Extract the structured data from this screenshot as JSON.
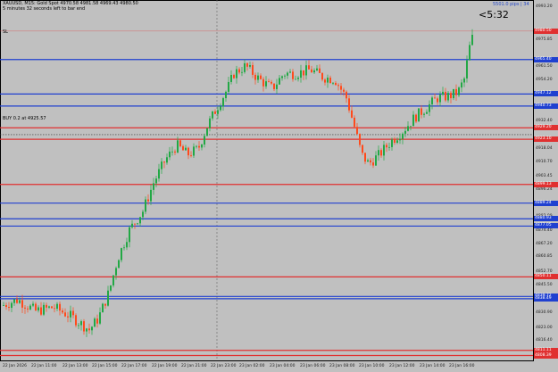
{
  "header": {
    "symbol_line": "XAUUSD, M15: Gold Spot  4970.58 4981.58 4969.43 4980.50",
    "timer_line": "5 minutes 32 seconds left to bar end"
  },
  "labels": {
    "sl": "SL",
    "buy": "BUY 0.2 at 4925.57"
  },
  "countdown": "<5:32",
  "pips_text": "5501.0 pips | 34",
  "y_axis_ticks": [
    "4993.20",
    "4975.85",
    "4961.50",
    "4954.20",
    "4940.20",
    "4932.40",
    "4918.04",
    "4910.70",
    "4903.45",
    "4896.24",
    "4882.09",
    "4874.40",
    "4867.20",
    "4860.85",
    "4852.70",
    "4845.50",
    "4838.30",
    "4830.90",
    "4823.00",
    "4816.40",
    "4809.10"
  ],
  "x_axis_ticks": [
    "22 Jan 2026",
    "22 Jan 11:00",
    "22 Jan 13:00",
    "22 Jan 15:00",
    "22 Jan 17:00",
    "22 Jan 19:00",
    "22 Jan 21:00",
    "22 Jan 23:00",
    "23 Jan 02:00",
    "23 Jan 04:00",
    "23 Jan 06:00",
    "23 Jan 08:00",
    "23 Jan 10:00",
    "23 Jan 12:00",
    "23 Jan 14:00",
    "23 Jan 16:00"
  ],
  "price_tags": [
    {
      "price": 4980.5,
      "text": "4980.50",
      "color": "#e03030"
    },
    {
      "price": 4965.4,
      "text": "4965.40",
      "color": "#2040d0"
    },
    {
      "price": 4947.12,
      "text": "4947.12",
      "color": "#2040d0"
    },
    {
      "price": 4940.73,
      "text": "4940.73",
      "color": "#2040d0"
    },
    {
      "price": 4929.2,
      "text": "4929.20",
      "color": "#e03030"
    },
    {
      "price": 4923.1,
      "text": "4923.10",
      "color": "#e03030"
    },
    {
      "price": 4899.13,
      "text": "4899.13",
      "color": "#e03030"
    },
    {
      "price": 4889.24,
      "text": "4889.24",
      "color": "#2040d0"
    },
    {
      "price": 4880.93,
      "text": "4880.93",
      "color": "#2040d0"
    },
    {
      "price": 4877.05,
      "text": "4877.05",
      "color": "#2040d0"
    },
    {
      "price": 4850.11,
      "text": "4850.11",
      "color": "#e03030"
    },
    {
      "price": 4839.72,
      "text": "4839.72",
      "color": "#2040d0"
    },
    {
      "price": 4838.49,
      "text": "4838.49",
      "color": "#2040d0"
    },
    {
      "price": 4811.11,
      "text": "4811.11",
      "color": "#e03030"
    },
    {
      "price": 4808.39,
      "text": "4808.39",
      "color": "#e03030"
    }
  ],
  "colors": {
    "background": "#c0c0c0",
    "bull": "#22a845",
    "bear": "#ff4a1c",
    "blue_line": "#2040d0",
    "red_line": "#e03030"
  }
}
